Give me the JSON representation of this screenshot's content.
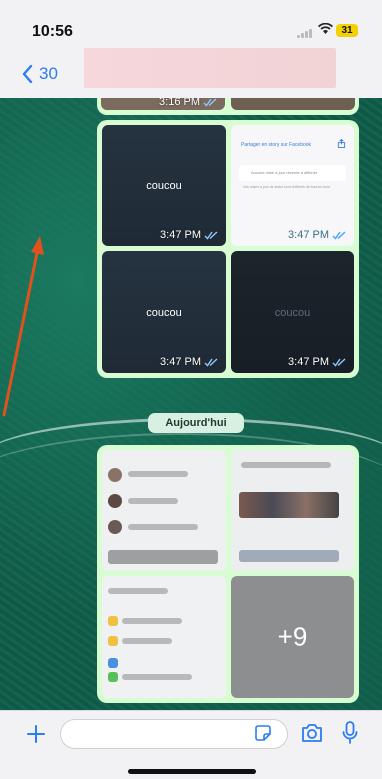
{
  "status_bar": {
    "time": "10:56",
    "battery": "31"
  },
  "nav": {
    "back_count": "30"
  },
  "messages": {
    "timestamps": [
      "3:16 PM",
      "3:47 PM",
      "3:47 PM",
      "3:47 PM",
      "3:47 PM"
    ],
    "tiles": {
      "coucou_1": "coucou",
      "coucou_2": "coucou",
      "coucou_3": "coucou",
      "story_title": "Partager en story sur Facebook",
      "story_body": "Aucune mise à jour récente à afficher",
      "story_footer": "Vos mises à jour de statut sont chiffrées de bout en bout"
    },
    "date_separator": "Aujourd'hui",
    "more_media": "+9"
  },
  "colors": {
    "accent": "#2b7df2",
    "bubble": "#d9fdd3",
    "wallpaper": "#0f5d4a",
    "arrow": "#e0521c"
  },
  "icons": [
    "chevron-left-icon",
    "plus-icon",
    "sticker-icon",
    "camera-icon",
    "mic-icon",
    "double-check-icon",
    "share-icon"
  ]
}
